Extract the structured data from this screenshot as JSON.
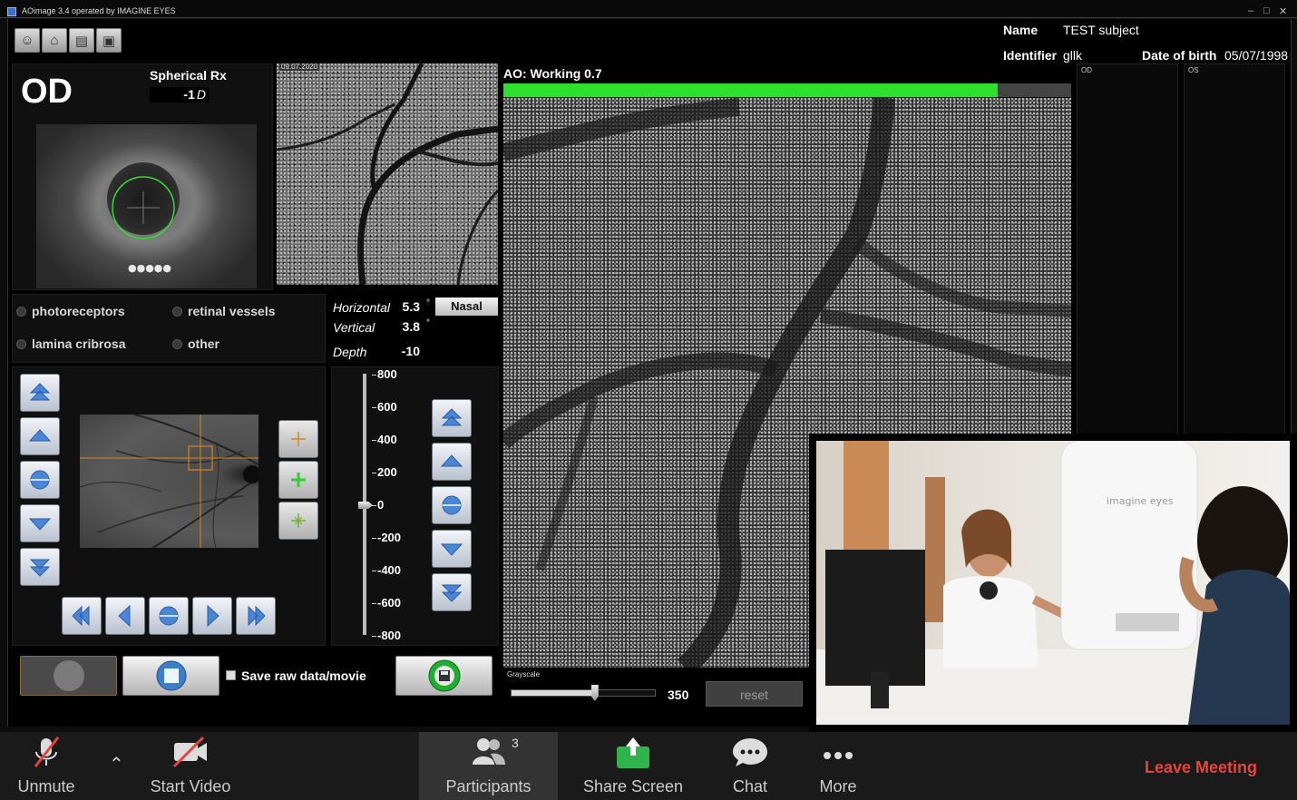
{
  "window": {
    "title": "AOimage 3.4 operated by IMAGINE EYES"
  },
  "patient": {
    "name_label": "Name",
    "name_value": "TEST subject",
    "identifier_label": "Identifier",
    "identifier_value": "gllk",
    "dob_label": "Date of birth",
    "dob_value": "05/07/1998",
    "eye_left_label": "OD",
    "eye_right_label": "OS"
  },
  "eye": {
    "side": "OD",
    "spherical_label": "Spherical Rx",
    "spherical_value": "-1",
    "spherical_unit": "D"
  },
  "fundus": {
    "date": "09.07.2020"
  },
  "modes": [
    {
      "label": "photoreceptors"
    },
    {
      "label": "retinal vessels"
    },
    {
      "label": "lamina cribrosa"
    },
    {
      "label": "other"
    }
  ],
  "position": {
    "horizontal_label": "Horizontal",
    "horizontal_value": "5.3",
    "horizontal_unit": "°",
    "direction_button": "Nasal",
    "vertical_label": "Vertical",
    "vertical_value": "3.8",
    "vertical_unit": "°",
    "depth_label": "Depth",
    "depth_value": "-10"
  },
  "depth_scale": {
    "ticks": [
      "800",
      "600",
      "400",
      "200",
      "0",
      "-200",
      "-400",
      "-600",
      "-800"
    ],
    "value": 0
  },
  "ao": {
    "status": "AO: Working 0.7",
    "progress": 0.87
  },
  "grayscale": {
    "label": "Grayscale",
    "value": "350",
    "reset_label": "reset",
    "level": 0.58
  },
  "controls": {
    "save_raw_label": "Save raw data/movie"
  },
  "colors": {
    "progress": "#2de02d",
    "reticle": "#33dd33",
    "crosshair": "#d6841f",
    "leave": "#e5453c"
  },
  "zoom": {
    "unmute": "Unmute",
    "start_video": "Start Video",
    "participants": "Participants",
    "participants_count": "3",
    "share_screen": "Share Screen",
    "chat": "Chat",
    "more": "More",
    "leave": "Leave Meeting"
  }
}
